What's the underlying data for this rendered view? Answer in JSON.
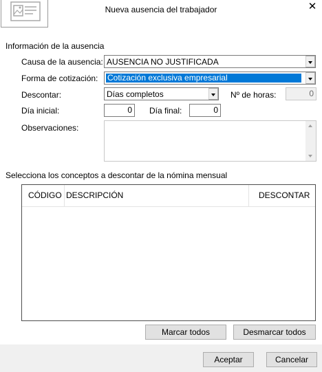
{
  "window": {
    "title": "Nueva ausencia del trabajador",
    "icon": "form-window-icon",
    "close": "close-icon"
  },
  "info_section": {
    "title": "Información de la ausencia",
    "causa_label": "Causa de la ausencia:",
    "causa_value": "AUSENCIA NO JUSTIFICADA",
    "forma_label": "Forma de cotización:",
    "forma_value": "Cotización exclusiva empresarial",
    "descontar_label": "Descontar:",
    "descontar_value": "Días completos",
    "horas_label": "Nº de horas:",
    "horas_value": "0",
    "dia_inicial_label": "Día inicial:",
    "dia_inicial_value": "0",
    "dia_final_label": "Día final:",
    "dia_final_value": "0",
    "observaciones_label": "Observaciones:",
    "observaciones_value": ""
  },
  "concepts_section": {
    "title": "Selecciona los conceptos a descontar de la nómina mensual",
    "columns": [
      "CÓDIGO",
      "DESCRIPCIÓN",
      "DESCONTAR"
    ],
    "rows": []
  },
  "buttons": {
    "marcar_todos": "Marcar todos",
    "desmarcar_todos": "Desmarcar todos",
    "aceptar": "Aceptar",
    "cancelar": "Cancelar"
  }
}
